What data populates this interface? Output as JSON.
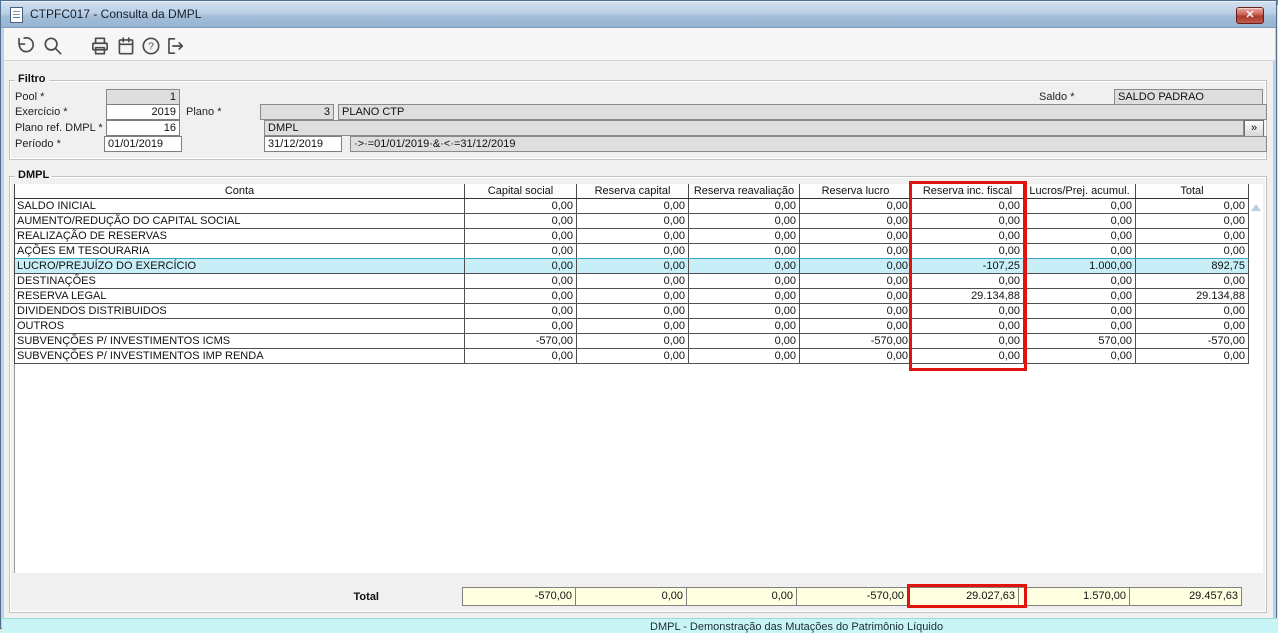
{
  "window": {
    "title": "CTPFC017 - Consulta da DMPL",
    "close_label": "✕"
  },
  "toolbar": {
    "icons": [
      "undo",
      "search",
      "print",
      "calendar",
      "help",
      "exit"
    ]
  },
  "filter": {
    "legend": "Filtro",
    "pool": {
      "label": "Pool *",
      "value": "1"
    },
    "exercicio": {
      "label": "Exercício *",
      "value": "2019"
    },
    "plano": {
      "label": "Plano *",
      "code": "3",
      "name": "PLANO CTP"
    },
    "plano_ref": {
      "label": "Plano ref. DMPL *",
      "code": "16",
      "name": "DMPL"
    },
    "periodo": {
      "label": "Período *",
      "date_from": "01/01/2019",
      "date_to": "31/12/2019",
      "expression": "·>·=01/01/2019·&·<·=31/12/2019"
    },
    "saldo": {
      "label": "Saldo *",
      "value": "SALDO PADRAO"
    },
    "expand_button": "»"
  },
  "table": {
    "legend": "DMPL",
    "columns": [
      "Conta",
      "Capital social",
      "Reserva capital",
      "Reserva reavaliação",
      "Reserva lucro",
      "Reserva inc. fiscal",
      "Lucros/Prej. acumul.",
      "Total"
    ],
    "rows": [
      {
        "conta": "SALDO INICIAL",
        "highlighted": false,
        "values": [
          "0,00",
          "0,00",
          "0,00",
          "0,00",
          "0,00",
          "0,00",
          "0,00"
        ]
      },
      {
        "conta": "AUMENTO/REDUÇÃO DO CAPITAL SOCIAL",
        "highlighted": false,
        "values": [
          "0,00",
          "0,00",
          "0,00",
          "0,00",
          "0,00",
          "0,00",
          "0,00"
        ]
      },
      {
        "conta": "REALIZAÇÃO DE RESERVAS",
        "highlighted": false,
        "values": [
          "0,00",
          "0,00",
          "0,00",
          "0,00",
          "0,00",
          "0,00",
          "0,00"
        ]
      },
      {
        "conta": "AÇÕES EM TESOURARIA",
        "highlighted": false,
        "values": [
          "0,00",
          "0,00",
          "0,00",
          "0,00",
          "0,00",
          "0,00",
          "0,00"
        ]
      },
      {
        "conta": "LUCRO/PREJUÍZO DO EXERCÍCIO",
        "highlighted": true,
        "values": [
          "0,00",
          "0,00",
          "0,00",
          "0,00",
          "-107,25",
          "1.000,00",
          "892,75"
        ]
      },
      {
        "conta": "DESTINAÇÕES",
        "highlighted": false,
        "values": [
          "0,00",
          "0,00",
          "0,00",
          "0,00",
          "0,00",
          "0,00",
          "0,00"
        ]
      },
      {
        "conta": "RESERVA LEGAL",
        "highlighted": false,
        "values": [
          "0,00",
          "0,00",
          "0,00",
          "0,00",
          "29.134,88",
          "0,00",
          "29.134,88"
        ]
      },
      {
        "conta": "DIVIDENDOS DISTRIBUIDOS",
        "highlighted": false,
        "values": [
          "0,00",
          "0,00",
          "0,00",
          "0,00",
          "0,00",
          "0,00",
          "0,00"
        ]
      },
      {
        "conta": "OUTROS",
        "highlighted": false,
        "values": [
          "0,00",
          "0,00",
          "0,00",
          "0,00",
          "0,00",
          "0,00",
          "0,00"
        ]
      },
      {
        "conta": "SUBVENÇÕES P/ INVESTIMENTOS ICMS",
        "highlighted": false,
        "values": [
          "-570,00",
          "0,00",
          "0,00",
          "-570,00",
          "0,00",
          "570,00",
          "-570,00"
        ]
      },
      {
        "conta": "SUBVENÇÕES P/ INVESTIMENTOS IMP RENDA",
        "highlighted": false,
        "values": [
          "0,00",
          "0,00",
          "0,00",
          "0,00",
          "0,00",
          "0,00",
          "0,00"
        ]
      }
    ],
    "total_label": "Total",
    "totals": [
      "-570,00",
      "0,00",
      "0,00",
      "-570,00",
      "29.027,63",
      "1.570,00",
      "29.457,63"
    ],
    "highlighted_column": "Reserva inc. fiscal"
  },
  "status_bar": {
    "text": "DMPL - Demonstração das Mutações do Patrimônio Líquido"
  },
  "colors": {
    "annotation_red": "#e0140c",
    "row_highlight": "#c8eef8",
    "total_field_bg": "#ffffe1",
    "statusbar_bg": "#c9f5f6",
    "titlebar_top": "#d3e1f1",
    "titlebar_bottom": "#96b4d3"
  }
}
